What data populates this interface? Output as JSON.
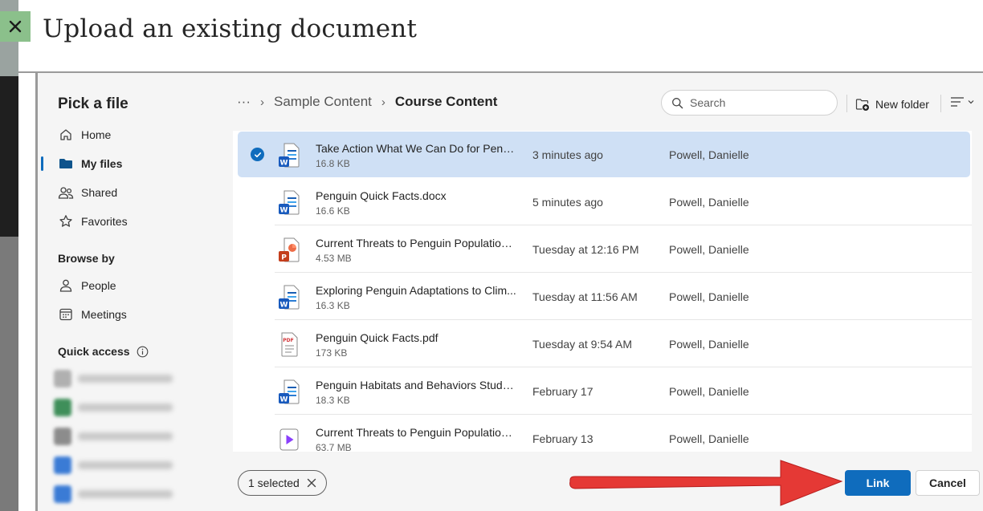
{
  "dialog": {
    "title": "Upload an existing document",
    "close_label": "Close"
  },
  "sidebar": {
    "title": "Pick a file",
    "nav": [
      {
        "label": "Home",
        "icon": "home-icon"
      },
      {
        "label": "My files",
        "icon": "folder-icon",
        "active": true
      },
      {
        "label": "Shared",
        "icon": "people-icon"
      },
      {
        "label": "Favorites",
        "icon": "star-icon"
      }
    ],
    "browse_by_label": "Browse by",
    "browse_by": [
      {
        "label": "People",
        "icon": "person-icon"
      },
      {
        "label": "Meetings",
        "icon": "calendar-icon"
      }
    ],
    "quick_access_label": "Quick access",
    "quick_access_colors": [
      "#b0b0b0",
      "#3f8f5a",
      "#8c8c8c",
      "#3a7bd5",
      "#3a7bd5"
    ]
  },
  "breadcrumb": {
    "overflow": "···",
    "items": [
      "Sample Content",
      "Course Content"
    ]
  },
  "search": {
    "placeholder": "Search"
  },
  "toolbar": {
    "new_folder_label": "New folder"
  },
  "files": [
    {
      "name": "Take Action What We Can Do for Penguins.docx",
      "display_name": "Take Action What We Can Do for Peng...",
      "size": "16.8 KB",
      "modified": "3 minutes ago",
      "owner": "Powell, Danielle",
      "type": "word",
      "selected": true
    },
    {
      "name": "Penguin Quick Facts.docx",
      "display_name": "Penguin Quick Facts.docx",
      "size": "16.6 KB",
      "modified": "5 minutes ago",
      "owner": "Powell, Danielle",
      "type": "word",
      "selected": false
    },
    {
      "name": "Current Threats to Penguin Population...",
      "display_name": "Current Threats to Penguin Population...",
      "size": "4.53 MB",
      "modified": "Tuesday at 12:16 PM",
      "owner": "Powell, Danielle",
      "type": "powerpoint",
      "selected": false
    },
    {
      "name": "Exploring Penguin Adaptations to Clim...",
      "display_name": "Exploring Penguin Adaptations to Clim...",
      "size": "16.3 KB",
      "modified": "Tuesday at 11:56 AM",
      "owner": "Powell, Danielle",
      "type": "word",
      "selected": false
    },
    {
      "name": "Penguin Quick Facts.pdf",
      "display_name": "Penguin Quick Facts.pdf",
      "size": "173 KB",
      "modified": "Tuesday at 9:54 AM",
      "owner": "Powell, Danielle",
      "type": "pdf",
      "selected": false
    },
    {
      "name": "Penguin Habitats and Behaviors Study ...",
      "display_name": "Penguin Habitats and Behaviors Study ...",
      "size": "18.3 KB",
      "modified": "February 17",
      "owner": "Powell, Danielle",
      "type": "word",
      "selected": false
    },
    {
      "name": "Current Threats to Penguin Population...",
      "display_name": "Current Threats to Penguin Population...",
      "size": "63.7 MB",
      "modified": "February 13",
      "owner": "Powell, Danielle",
      "type": "video",
      "selected": false
    }
  ],
  "footer": {
    "selected_count_label": "1 selected",
    "link_label": "Link",
    "cancel_label": "Cancel"
  },
  "colors": {
    "accent": "#0f6cbd",
    "selected_row": "#cfe0f5",
    "annotation_arrow": "#e53935",
    "close_button": "#8bc08b"
  }
}
